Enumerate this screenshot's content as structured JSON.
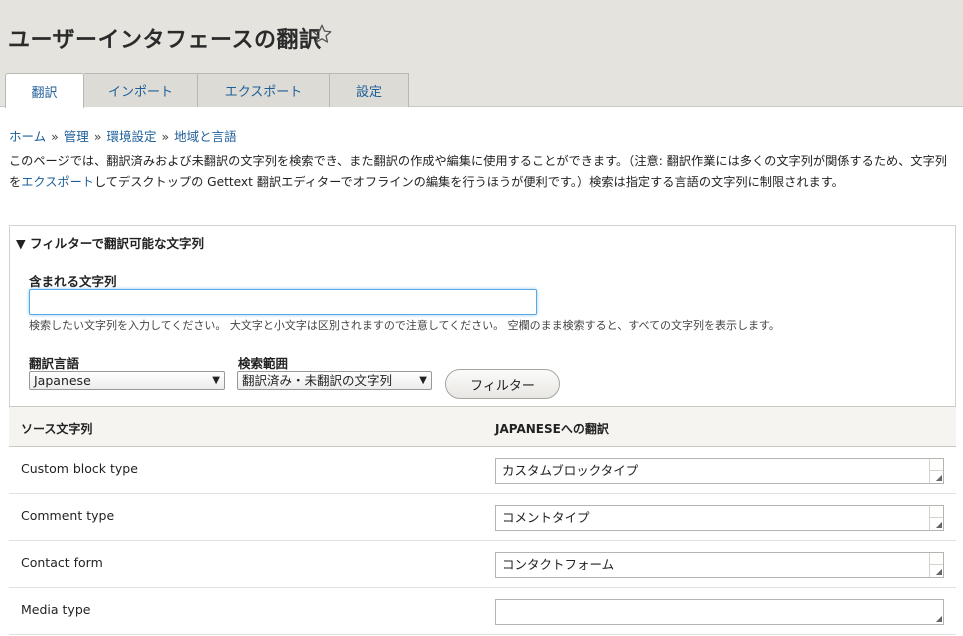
{
  "page": {
    "title": "ユーザーインタフェースの翻訳"
  },
  "tabs": [
    {
      "label": "翻訳",
      "active": true
    },
    {
      "label": "インポート",
      "active": false
    },
    {
      "label": "エクスポート",
      "active": false
    },
    {
      "label": "設定",
      "active": false
    }
  ],
  "breadcrumb": {
    "items": [
      "ホーム",
      "管理",
      "環境設定",
      "地域と言語"
    ],
    "separator": "»"
  },
  "description": {
    "part1": "このページでは、翻訳済みおよび未翻訳の文字列を検索でき、また翻訳の作成や編集に使用することができます。（注意: 翻訳作業には多くの文字列が関係するため、文字列を",
    "link": "エクスポート",
    "part2": "してデスクトップの Gettext 翻訳エディターでオフラインの編集を行うほうが便利です。）検索は指定する言語の文字列に制限されます。"
  },
  "filter": {
    "legend": "▼ フィルターで翻訳可能な文字列",
    "contains_label": "含まれる文字列",
    "contains_value": "",
    "hint": "検索したい文字列を入力してください。 大文字と小文字は区別されますので注意してください。 空欄のまま検索すると、すべての文字列を表示します。",
    "language_label": "翻訳言語",
    "language_value": "Japanese",
    "scope_label": "検索範囲",
    "scope_value": "翻訳済み・未翻訳の文字列",
    "button_label": "フィルター"
  },
  "table": {
    "header_source": "ソース文字列",
    "header_translation": "JAPANESEへの翻訳",
    "rows": [
      {
        "source": "Custom block type",
        "translation": "カスタムブロックタイプ"
      },
      {
        "source": "Comment type",
        "translation": "コメントタイプ"
      },
      {
        "source": "Contact form",
        "translation": "コンタクトフォーム"
      },
      {
        "source": "Media type",
        "translation": ""
      }
    ]
  },
  "icons": {
    "star": "star-outline-icon",
    "dropdown": "triangle-down-icon",
    "resize": "resize-grip-icon"
  },
  "colors": {
    "link": "#1e5f99",
    "header_bg": "#e4e3dd",
    "focus_border": "#5aa9e6"
  }
}
